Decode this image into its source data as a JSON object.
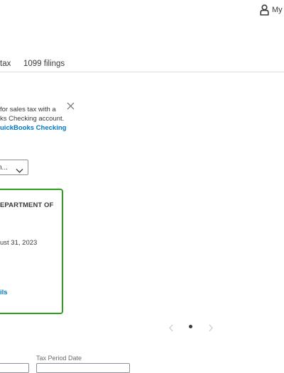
{
  "header": {
    "account_label": "My",
    "account_icon": "user-icon"
  },
  "tabs": [
    {
      "label": "tax"
    },
    {
      "label": "1099 filings"
    }
  ],
  "banner": {
    "line1": "for sales tax with a",
    "line2": "ks Checking account.",
    "link": "uickBooks Checking",
    "close_icon": "close-icon"
  },
  "filter": {
    "selected_value": "n...",
    "chevron_icon": "chevron-down-icon"
  },
  "card": {
    "title": "EPARTMENT OF",
    "date": "ust 31, 2023",
    "link": "ils",
    "border_color": "#2ca01c"
  },
  "carousel": {
    "prev_icon": "chevron-left-icon",
    "next_icon": "chevron-right-icon"
  },
  "form": {
    "tax_period_label": "Tax Period Date"
  },
  "colors": {
    "link": "#0077c5",
    "text": "#393a3d",
    "accent_green": "#2ca01c"
  }
}
